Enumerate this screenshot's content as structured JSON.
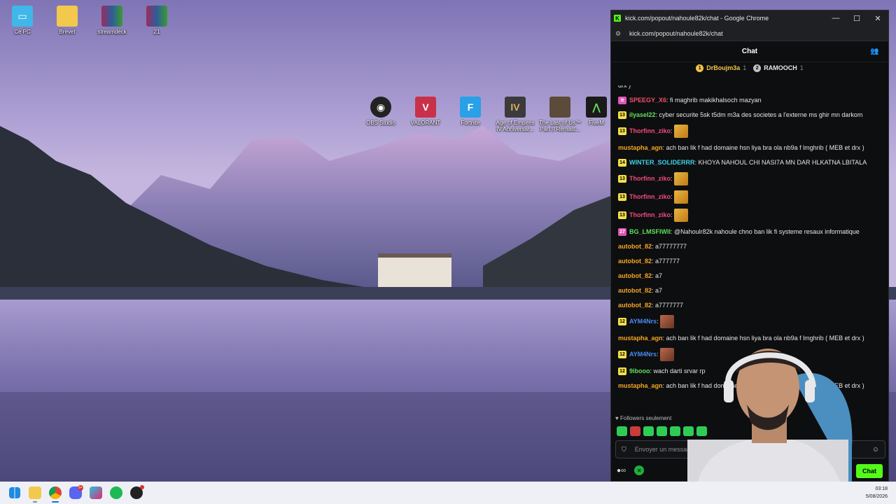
{
  "desktop": {
    "icons_top": [
      {
        "label": "Ce PC",
        "icon": "monitor-icon",
        "color": "#3fb7e8"
      },
      {
        "label": "Brevet",
        "icon": "folder-icon",
        "color": "#f2c94c"
      },
      {
        "label": "streamdeck",
        "icon": "winrar-icon",
        "color": "#9b2d5c"
      },
      {
        "label": "21",
        "icon": "winrar-icon",
        "color": "#9b2d5c"
      }
    ],
    "icons_mid": [
      {
        "label": "OBS Studio",
        "icon": "obs-icon",
        "color": "#222222"
      },
      {
        "label": "VALORANT",
        "icon": "valorant-icon",
        "color": "#c9314a"
      },
      {
        "label": "Fortnite",
        "icon": "fortnite-icon",
        "color": "#2aa0e8"
      },
      {
        "label": "Age of Empires IV Anniversar...",
        "icon": "aoe-icon",
        "color": "#3b3b3b"
      },
      {
        "label": "The Last of Us™ Part II Remast...",
        "icon": "tlou-icon",
        "color": "#5c4a3a"
      },
      {
        "label": "FiveM",
        "icon": "fivem-icon",
        "color": "#1a1a1a"
      }
    ]
  },
  "window": {
    "title": "kick.com/popout/nahoule82k/chat - Google Chrome",
    "url": "kick.com/popout/nahoule82k/chat",
    "minimize": "—",
    "maximize": "☐",
    "close": "✕"
  },
  "chat": {
    "header_title": "Chat",
    "leaders": [
      {
        "rank": "1",
        "name": "DrBoujm3a",
        "count": "1",
        "color": "#f5c542"
      },
      {
        "rank": "2",
        "name": "RAMOOCH",
        "count": "1",
        "color": "#c0c0c0"
      }
    ],
    "messages": [
      {
        "badge": "",
        "badge_color": "",
        "user": "",
        "user_color": "#e6e6e6",
        "text": "drx )",
        "emote": ""
      },
      {
        "badge": "≋",
        "badge_color": "#e055b5",
        "user": "SPEEGY_X6",
        "user_color": "#f2506a",
        "text": ": fi maghrib makikhalsoch mazyan",
        "emote": ""
      },
      {
        "badge": "13",
        "badge_color": "#f5e04a",
        "user": "ilyasel22",
        "user_color": "#5fe05a",
        "text": ": cyber securite 5sk t5dm m3a des societes a l'externe ms ghir mn darkom",
        "emote": ""
      },
      {
        "badge": "13",
        "badge_color": "#f5e04a",
        "user": "Thorfinn_ziko",
        "user_color": "#f24a7a",
        "text": ":",
        "emote": "a"
      },
      {
        "badge": "",
        "badge_color": "",
        "user": "mustapha_agn",
        "user_color": "#f5a623",
        "text": ": ach ban lik f had domaine hsn liya bra ola nb9a f lmghrib ( MEB et drx )",
        "emote": ""
      },
      {
        "badge": "14",
        "badge_color": "#f5e04a",
        "user": "WINTER_SOLIDERRR",
        "user_color": "#3ed2e8",
        "text": ": KHOYA NAHOUL CHI NASI7A MN DAR HLKATNA LBITALA",
        "emote": ""
      },
      {
        "badge": "13",
        "badge_color": "#f5e04a",
        "user": "Thorfinn_ziko",
        "user_color": "#f24a7a",
        "text": ":",
        "emote": "a"
      },
      {
        "badge": "13",
        "badge_color": "#f5e04a",
        "user": "Thorfinn_ziko",
        "user_color": "#f24a7a",
        "text": ":",
        "emote": "a"
      },
      {
        "badge": "13",
        "badge_color": "#f5e04a",
        "user": "Thorfinn_ziko",
        "user_color": "#f24a7a",
        "text": ":",
        "emote": "a"
      },
      {
        "badge": "27",
        "badge_color": "#e055b5",
        "user": "BG_LMSFIWII",
        "user_color": "#5fe05a",
        "text": ": @Nahoulr82k nahoule chno ban lik fi systeme resaux informatique",
        "emote": ""
      },
      {
        "badge": "",
        "badge_color": "",
        "user": "autobot_82",
        "user_color": "#f5a623",
        "text": ": a77777777",
        "emote": ""
      },
      {
        "badge": "",
        "badge_color": "",
        "user": "autobot_82",
        "user_color": "#f5a623",
        "text": ": a777777",
        "emote": ""
      },
      {
        "badge": "",
        "badge_color": "",
        "user": "autobot_82",
        "user_color": "#f5a623",
        "text": ": a7",
        "emote": ""
      },
      {
        "badge": "",
        "badge_color": "",
        "user": "autobot_82",
        "user_color": "#f5a623",
        "text": ": a7",
        "emote": ""
      },
      {
        "badge": "",
        "badge_color": "",
        "user": "autobot_82",
        "user_color": "#f5a623",
        "text": ": a7777777",
        "emote": ""
      },
      {
        "badge": "12",
        "badge_color": "#f5e04a",
        "user": "AYM4Nrs",
        "user_color": "#4a8cf2",
        "text": ":",
        "emote": "b"
      },
      {
        "badge": "",
        "badge_color": "",
        "user": "mustapha_agn",
        "user_color": "#f5a623",
        "text": ": ach ban lik f had domaine hsn liya bra ola nb9a f lmghrib ( MEB et drx )",
        "emote": ""
      },
      {
        "badge": "12",
        "badge_color": "#f5e04a",
        "user": "AYM4Nrs",
        "user_color": "#4a8cf2",
        "text": ":",
        "emote": "b"
      },
      {
        "badge": "12",
        "badge_color": "#f5e04a",
        "user": "9ibooo",
        "user_color": "#5fe05a",
        "text": ": wach darti srvar rp",
        "emote": ""
      },
      {
        "badge": "",
        "badge_color": "",
        "user": "mustapha_agn",
        "user_color": "#f5a623",
        "text": ": ach ban lik f had domaine hsn liya bra ola nb9a f lmghrib ( MEB et drx )",
        "emote": ""
      }
    ],
    "followers_only": "Followers seulement",
    "input_placeholder": "Envoyer un message",
    "send_label": "Chat",
    "infinity": "∞"
  },
  "taskbar": {
    "time": "03:18",
    "date": "5/08/2026",
    "discord_badge": "9+"
  }
}
